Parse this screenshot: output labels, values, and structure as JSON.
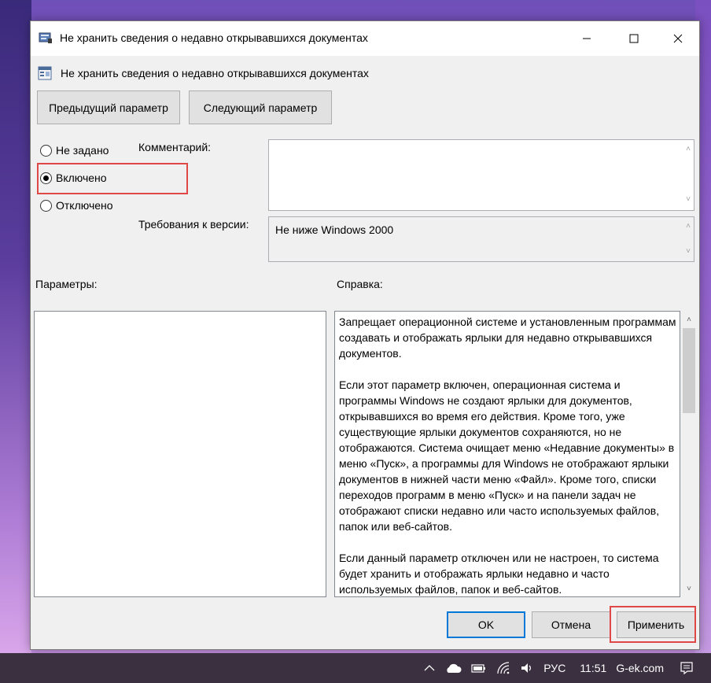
{
  "window": {
    "title": "Не хранить сведения о недавно открывавшихся документах",
    "header_title": "Не хранить сведения о недавно открывавшихся документах"
  },
  "nav": {
    "prev_label": "Предыдущий параметр",
    "next_label": "Следующий параметр"
  },
  "state": {
    "options": [
      {
        "label": "Не задано",
        "checked": false
      },
      {
        "label": "Включено",
        "checked": true
      },
      {
        "label": "Отключено",
        "checked": false
      }
    ]
  },
  "comment": {
    "label": "Комментарий:",
    "value": ""
  },
  "version": {
    "label": "Требования к версии:",
    "value": "Не ниже Windows 2000"
  },
  "params": {
    "label": "Параметры:"
  },
  "help": {
    "label": "Справка:",
    "paragraphs": [
      "Запрещает операционной системе и установленным программам создавать и отображать ярлыки для недавно открывавшихся документов.",
      "Если этот параметр включен, операционная система и программы Windows не создают ярлыки для документов, открывавшихся во время его действия. Кроме того, уже существующие ярлыки документов сохраняются, но не отображаются. Система очищает меню «Недавние документы» в меню «Пуск», а программы для Windows не отображают ярлыки документов в нижней части меню «Файл». Кроме того, списки переходов программ в меню «Пуск» и на панели задач не отображают списки недавно или часто используемых файлов, папок или веб-сайтов.",
      "Если данный параметр отключен или не настроен, то система будет хранить и отображать ярлыки недавно и часто используемых файлов, папок и веб-сайтов."
    ]
  },
  "footer": {
    "ok_label": "OK",
    "cancel_label": "Отмена",
    "apply_label": "Применить"
  },
  "taskbar": {
    "language": "РУС",
    "time": "11:51",
    "site": "G-ek.com"
  },
  "colors": {
    "highlight": "#e04848",
    "focus": "#0078d7"
  }
}
